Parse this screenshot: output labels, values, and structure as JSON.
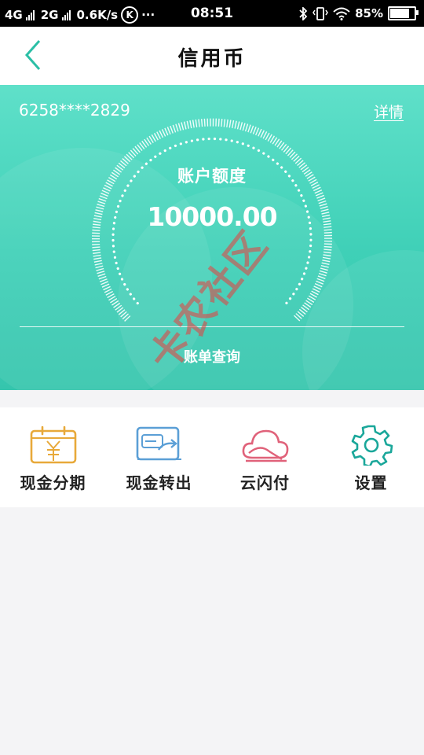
{
  "status_bar": {
    "network_1": "4G",
    "network_2": "2G",
    "speed": "0.6K/s",
    "k_badge": "K",
    "more": "···",
    "time": "08:51",
    "battery_text": "85%",
    "battery_level": 0.85
  },
  "header": {
    "title": "信用币",
    "back_icon": "chevron-left-icon"
  },
  "card": {
    "number": "6258****2829",
    "detail_label": "详情",
    "gauge_label": "账户额度",
    "gauge_value": "10000.00",
    "bill_query_label": "账单查询"
  },
  "menu": {
    "items": [
      {
        "label": "现金分期",
        "icon": "calendar-yuan-icon"
      },
      {
        "label": "现金转出",
        "icon": "cash-transfer-icon"
      },
      {
        "label": "云闪付",
        "icon": "cloud-pay-icon"
      },
      {
        "label": "设置",
        "icon": "gear-icon"
      }
    ]
  },
  "watermark": "卡农社区",
  "colors": {
    "accent": "#40d2b9",
    "back_icon": "#2bbfa6",
    "installment_icon": "#e8a93a",
    "transfer_icon": "#5b9fd6",
    "cloud_icon": "#e0627a",
    "settings_icon": "#1aa79a"
  }
}
